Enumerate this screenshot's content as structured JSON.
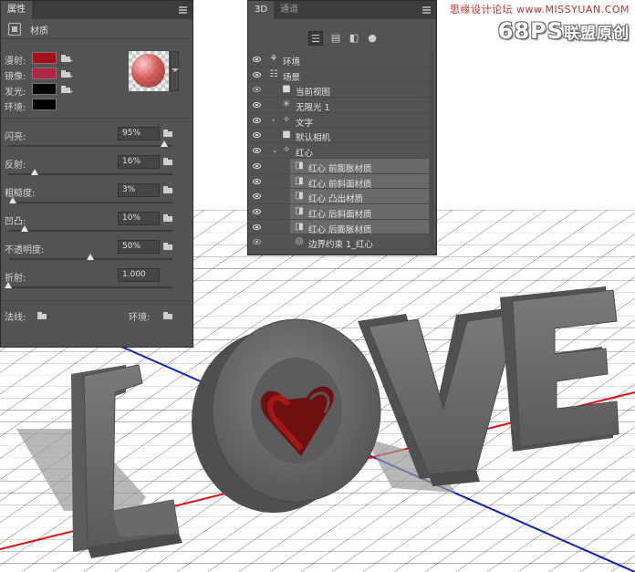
{
  "watermark": {
    "top": "思缘设计论坛 www.MISSYUAN.COM",
    "logo": "68PS",
    "logo_cn": "联盟原创"
  },
  "properties_panel": {
    "tab_label": "属性",
    "header_label": "材质",
    "colors": [
      {
        "label": "漫射:",
        "color": "#a5101b"
      },
      {
        "label": "镜像:",
        "color": "#b02543"
      },
      {
        "label": "发光:",
        "color": "#000000"
      },
      {
        "label": "环境:",
        "color": "#000000"
      }
    ],
    "sliders": [
      {
        "label": "闪亮:",
        "value": "95%",
        "level": 0.95
      },
      {
        "label": "反射:",
        "value": "16%",
        "level": 0.16
      },
      {
        "label": "粗糙度:",
        "value": "3%",
        "level": 0.03
      },
      {
        "label": "凹凸:",
        "value": "10%",
        "level": 0.1
      },
      {
        "label": "不透明度:",
        "value": "50%",
        "level": 0.5
      },
      {
        "label": "折射:",
        "value": "1.000",
        "level": 0.0
      }
    ],
    "normal_label": "法线:",
    "environment_label": "环境:"
  },
  "panel_3d": {
    "tabs": [
      "3D",
      "通道"
    ],
    "tree": [
      {
        "label": "环境",
        "icon": "environment-icon",
        "level": 0,
        "twist": "",
        "visible": true,
        "highlight": false
      },
      {
        "label": "场景",
        "icon": "scene-icon",
        "level": 0,
        "twist": "",
        "visible": true,
        "highlight": false
      },
      {
        "label": "当前视图",
        "icon": "camera-icon",
        "level": 1,
        "twist": "",
        "visible": false,
        "highlight": false
      },
      {
        "label": "无限光 1",
        "icon": "light-icon",
        "level": 1,
        "twist": "",
        "visible": true,
        "highlight": false
      },
      {
        "label": "文字",
        "icon": "mesh-icon",
        "level": 1,
        "twist": ">",
        "visible": true,
        "highlight": false
      },
      {
        "label": "默认相机",
        "icon": "camera-icon",
        "level": 1,
        "twist": "",
        "visible": true,
        "highlight": false
      },
      {
        "label": "红心",
        "icon": "mesh-icon",
        "level": 1,
        "twist": "v",
        "visible": true,
        "highlight": false
      },
      {
        "label": "红心 前膨胀材质",
        "icon": "material-icon",
        "level": 2,
        "twist": "",
        "visible": true,
        "highlight": true
      },
      {
        "label": "红心 前斜面材质",
        "icon": "material-icon",
        "level": 2,
        "twist": "",
        "visible": true,
        "highlight": true
      },
      {
        "label": "红心 凸出材质",
        "icon": "material-icon",
        "level": 2,
        "twist": "",
        "visible": true,
        "highlight": true
      },
      {
        "label": "红心 后斜面材质",
        "icon": "material-icon",
        "level": 2,
        "twist": "",
        "visible": true,
        "highlight": true
      },
      {
        "label": "红心 后膨胀材质",
        "icon": "material-icon",
        "level": 2,
        "twist": "",
        "visible": true,
        "highlight": true
      },
      {
        "label": "边界约束 1_红心",
        "icon": "constraint-icon",
        "level": 2,
        "twist": "",
        "visible": false,
        "highlight": false
      }
    ]
  }
}
